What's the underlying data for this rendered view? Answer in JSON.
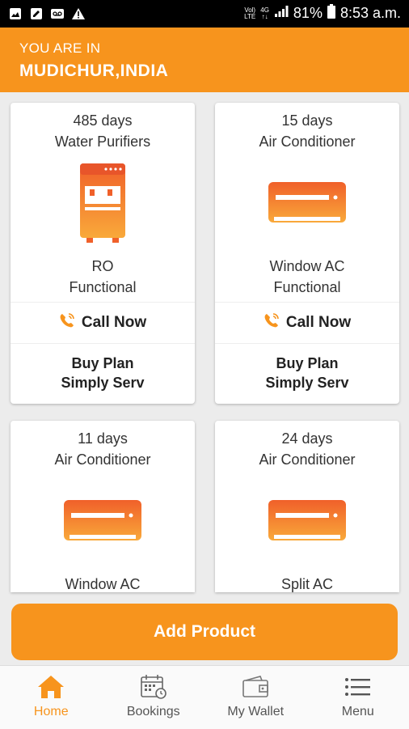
{
  "status_bar": {
    "network_top": "Vol)",
    "network_bottom": "LTE",
    "gen_top": "4G",
    "gen_bottom": "↑↓",
    "battery": "81%",
    "time": "8:53 a.m."
  },
  "header": {
    "subtitle": "YOU ARE IN",
    "location": "MUDICHUR,INDIA"
  },
  "products": [
    {
      "days": "485 days",
      "category": "Water Purifiers",
      "type": "RO",
      "status": "Functional",
      "call": "Call Now",
      "plan_line1": "Buy Plan",
      "plan_line2": "Simply Serv",
      "icon": "water-purifier-icon"
    },
    {
      "days": "15 days",
      "category": "Air Conditioner",
      "type": "Window AC",
      "status": "Functional",
      "call": "Call Now",
      "plan_line1": "Buy Plan",
      "plan_line2": "Simply Serv",
      "icon": "air-conditioner-icon"
    },
    {
      "days": "11 days",
      "category": "Air Conditioner",
      "type": "Window AC",
      "icon": "air-conditioner-icon"
    },
    {
      "days": "24 days",
      "category": "Air Conditioner",
      "type": "Split AC",
      "icon": "air-conditioner-icon"
    }
  ],
  "add_product_label": "Add Product",
  "nav": [
    {
      "label": "Home",
      "icon": "home-icon",
      "active": true
    },
    {
      "label": "Bookings",
      "icon": "calendar-icon"
    },
    {
      "label": "My Wallet",
      "icon": "wallet-icon"
    },
    {
      "label": "Menu",
      "icon": "menu-icon"
    }
  ],
  "colors": {
    "accent": "#f7941d",
    "status_bar": "#000000",
    "background": "#ececec"
  }
}
